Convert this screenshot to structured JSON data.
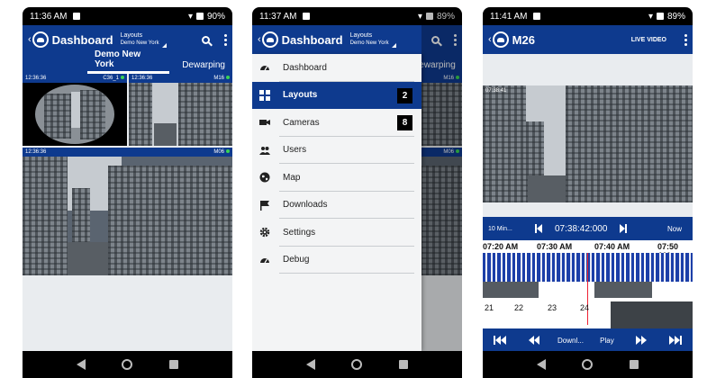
{
  "colors": {
    "brand_blue": "#0e3a8e",
    "online_dot": "#39d353",
    "nav_black": "#000000"
  },
  "screens": [
    {
      "status": {
        "time": "11:36 AM",
        "battery": "90%"
      },
      "appbar": {
        "title": "Dashboard",
        "layout_label": "Layouts",
        "layout_value": "Demo New York"
      },
      "tabs": [
        {
          "label": "Demo New York"
        },
        {
          "label": "Dewarping"
        }
      ],
      "cameras": [
        {
          "time": "12:36:36",
          "name": "C36_1"
        },
        {
          "time": "12:36:36",
          "name": "M16"
        },
        {
          "time": "12:36:36",
          "name": "M06"
        }
      ]
    },
    {
      "status": {
        "time": "11:37 AM",
        "battery": "89%"
      },
      "appbar": {
        "title": "Dashboard",
        "layout_label": "Layouts",
        "layout_value": "Demo New York"
      },
      "tab_peek": "Dewarping",
      "peek_cams": [
        {
          "name": "M16"
        },
        {
          "name": "M06"
        }
      ],
      "drawer": [
        {
          "label": "Dashboard",
          "icon": "speedometer-icon",
          "active": false,
          "badge": ""
        },
        {
          "label": "Layouts",
          "icon": "grid-icon",
          "active": true,
          "badge": "2"
        },
        {
          "label": "Cameras",
          "icon": "camera-icon",
          "active": false,
          "badge": "8"
        },
        {
          "label": "Users",
          "icon": "users-icon",
          "active": false,
          "badge": ""
        },
        {
          "label": "Map",
          "icon": "globe-icon",
          "active": false,
          "badge": ""
        },
        {
          "label": "Downloads",
          "icon": "flag-icon",
          "active": false,
          "badge": ""
        },
        {
          "label": "Settings",
          "icon": "gear-icon",
          "active": false,
          "badge": ""
        },
        {
          "label": "Debug",
          "icon": "speedometer-icon",
          "active": false,
          "badge": ""
        }
      ]
    },
    {
      "status": {
        "time": "11:41 AM",
        "battery": "89%"
      },
      "appbar": {
        "title": "M26",
        "live_label": "LIVE VIDEO"
      },
      "video_time": "07:38:41",
      "playback": {
        "interval": "10 Min...",
        "current_time": "07:38:42:000",
        "now_label": "Now",
        "time_labels": [
          "07:20 AM",
          "07:30 AM",
          "07:40 AM",
          "07:50 AM"
        ],
        "days": [
          "21",
          "22",
          "23",
          "24"
        ],
        "controls": [
          "Downl...",
          "Play"
        ]
      }
    }
  ]
}
